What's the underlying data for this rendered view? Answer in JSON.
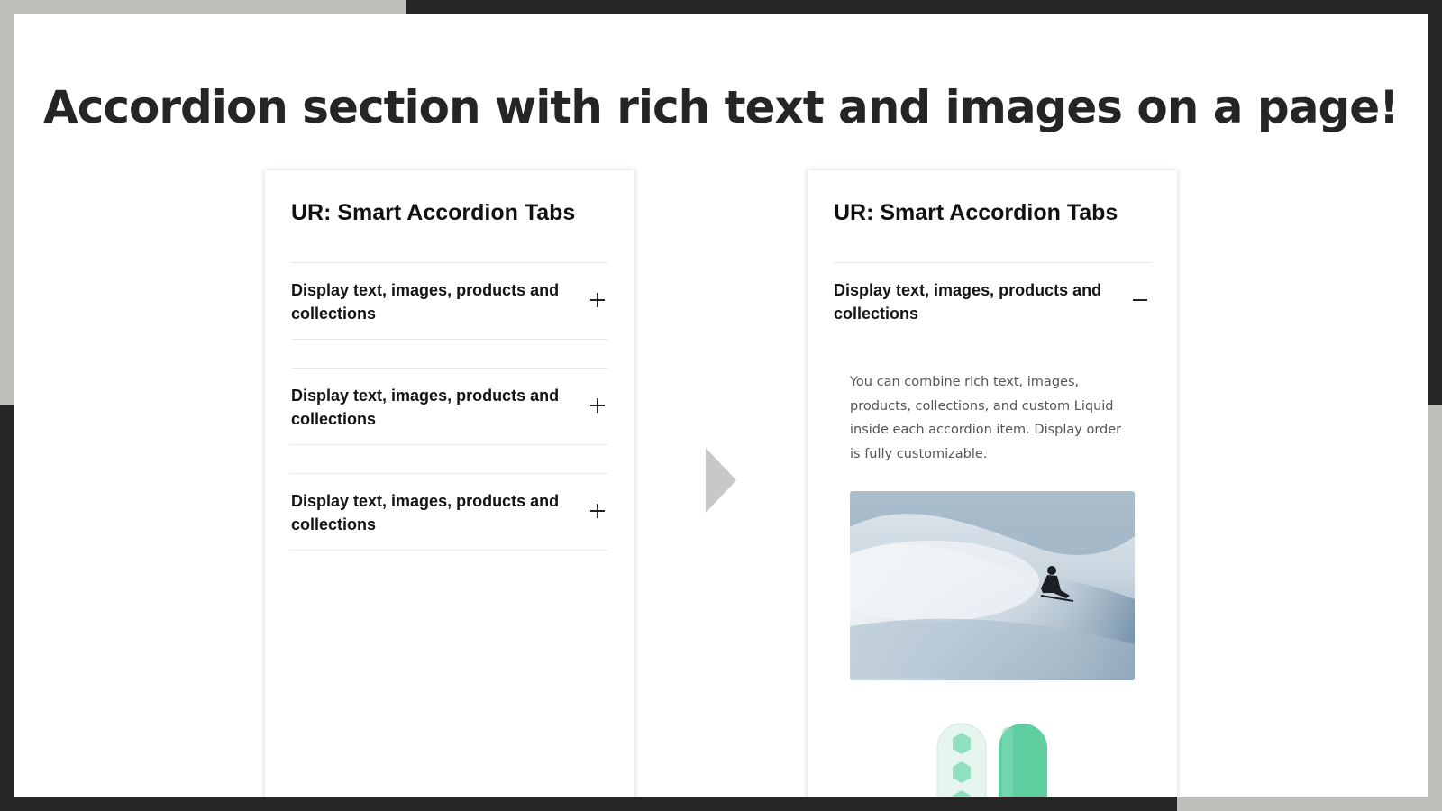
{
  "headline": "Accordion section with rich text and images on a page!",
  "left_panel": {
    "title": "UR: Smart Accordion Tabs",
    "items": [
      {
        "label": "Display text, images, products and collections",
        "icon": "plus-icon"
      },
      {
        "label": "Display text, images, products and collections",
        "icon": "plus-icon"
      },
      {
        "label": "Display text, images, products and collections",
        "icon": "plus-icon"
      }
    ]
  },
  "right_panel": {
    "title": "UR: Smart Accordion Tabs",
    "open_item": {
      "label": "Display text, images, products and collections",
      "icon": "minus-icon",
      "body": "You can combine rich text, images, products, collections, and custom Liquid inside each accordion item. Display order is fully customizable.",
      "image": "snowboarder-photo",
      "product_image": "snowboards-image"
    }
  },
  "colors": {
    "frame_light": "#bdbfbb",
    "frame_dark": "#252525",
    "arrow": "#c8c8c8",
    "board_teal": "#5fcfa2"
  }
}
